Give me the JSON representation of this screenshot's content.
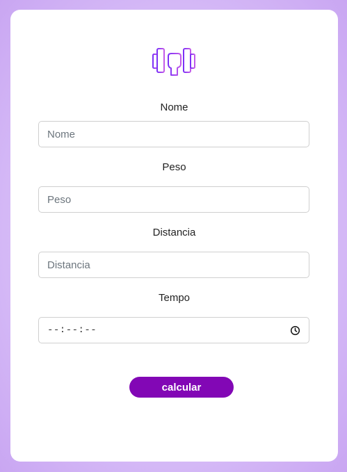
{
  "form": {
    "logo_icon": "dumbbell-hand-icon",
    "accent_color": "#8207b5",
    "fields": {
      "nome": {
        "label": "Nome",
        "placeholder": "Nome"
      },
      "peso": {
        "label": "Peso",
        "placeholder": "Peso"
      },
      "distancia": {
        "label": "Distancia",
        "placeholder": "Distancia"
      },
      "tempo": {
        "label": "Tempo",
        "value": "--:--:--",
        "icon": "clock-icon"
      }
    },
    "submit_label": "calcular"
  }
}
